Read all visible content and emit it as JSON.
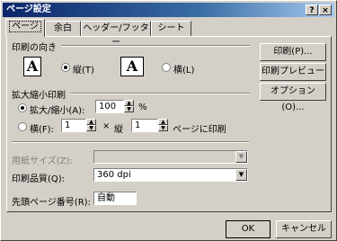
{
  "window": {
    "title": "ページ設定",
    "help_glyph": "?",
    "close_glyph": "×"
  },
  "tabs": [
    {
      "label": "ページ",
      "active": true
    },
    {
      "label": "余白"
    },
    {
      "label": "ヘッダー/フッター"
    },
    {
      "label": "シート"
    }
  ],
  "orientation": {
    "label": "印刷の向き",
    "portrait_glyph": "A",
    "portrait_label": "縦(T)",
    "landscape_glyph": "A",
    "landscape_label": "横(L)",
    "selected": "portrait"
  },
  "scaling": {
    "label": "拡大縮小印刷",
    "zoom_label": "拡大/縮小(A):",
    "zoom_value": "100",
    "percent": "%",
    "fit_label": "横(F):",
    "fit_wide": "1",
    "times": "×",
    "tall_label": "縦",
    "fit_tall": "1",
    "fit_suffix": "ページに印刷",
    "selected": "zoom"
  },
  "paper_size": {
    "label": "用紙サイズ(Z):",
    "value": ""
  },
  "print_quality": {
    "label": "印刷品質(Q):",
    "value": "360 dpi"
  },
  "first_page": {
    "label": "先頭ページ番号(R):",
    "value": "自動"
  },
  "side_buttons": {
    "print": "印刷(P)...",
    "preview": "印刷プレビュー(W)",
    "options": "オプション(O)..."
  },
  "footer": {
    "ok": "OK",
    "cancel": "キャンセル"
  }
}
